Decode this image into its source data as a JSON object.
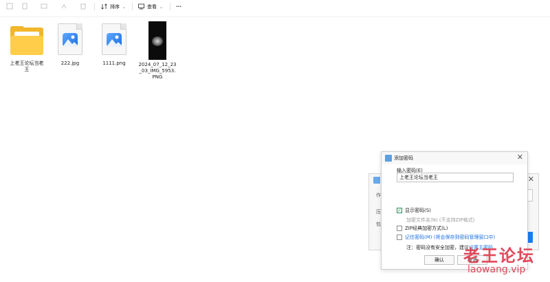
{
  "toolbar": {
    "sort_label": "排序",
    "view_label": "查看",
    "more_label": "···"
  },
  "files": [
    {
      "name": "上老王论坛当老王",
      "icon": "folder-icon"
    },
    {
      "name": "222.jpg",
      "icon": "image-file-icon"
    },
    {
      "name": "1111.png",
      "icon": "image-file-icon"
    },
    {
      "name": "2024_07_12_23_03_IMG_5953.PNG",
      "icon": "image-thumbnail"
    }
  ],
  "dialog": {
    "title": "添加密码",
    "password_label": "输入密码(E)",
    "password_value": "上老王论坛当老王",
    "options": {
      "show_password": {
        "label": "显示密码(S)",
        "checked": true
      },
      "encrypt_filenames": {
        "label": "加密文件名(N) (不支持ZIP格式)",
        "checked": false
      },
      "zip_classic": {
        "label": "ZIP经典加密方式(L)",
        "checked": false
      },
      "remember_password": {
        "label": "记住密码(M) (将会保存到密码管理窗口中)",
        "checked": false
      }
    },
    "note_prefix": "注：密码没有安全加密，建议",
    "note_highlight": "设置主密码",
    "ok_label": "确认",
    "cancel_label": "取消"
  },
  "back_window": {
    "row1": "作",
    "row2": "压",
    "row3": "包"
  },
  "watermark": {
    "title": "老王论坛",
    "url": "laowang.vip"
  },
  "colors": {
    "accent": "#1a7ef0",
    "folder": "#f2b62b",
    "watermark": "#e0495a"
  }
}
